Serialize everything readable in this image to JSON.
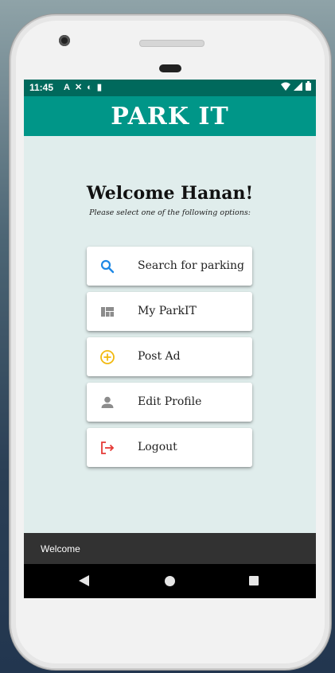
{
  "status_bar": {
    "time": "11:45",
    "left_icons": [
      "A",
      "✕",
      "◐",
      "▮"
    ]
  },
  "app_bar": {
    "title": "PARK IT",
    "color": "#009688"
  },
  "main": {
    "welcome": "Welcome Hanan!",
    "subtitle": "Please select one of the following options:",
    "menu": [
      {
        "label": "Search for parking",
        "icon": "search-icon",
        "icon_color": "#1e88e5"
      },
      {
        "label": "My ParkIT",
        "icon": "dashboard-icon",
        "icon_color": "#8c8c8c"
      },
      {
        "label": "Post Ad",
        "icon": "add-circle-icon",
        "icon_color": "#f2b90f"
      },
      {
        "label": "Edit Profile",
        "icon": "person-icon",
        "icon_color": "#8c8c8c"
      },
      {
        "label": "Logout",
        "icon": "logout-icon",
        "icon_color": "#e53935"
      }
    ]
  },
  "snackbar": {
    "text": "Welcome"
  }
}
